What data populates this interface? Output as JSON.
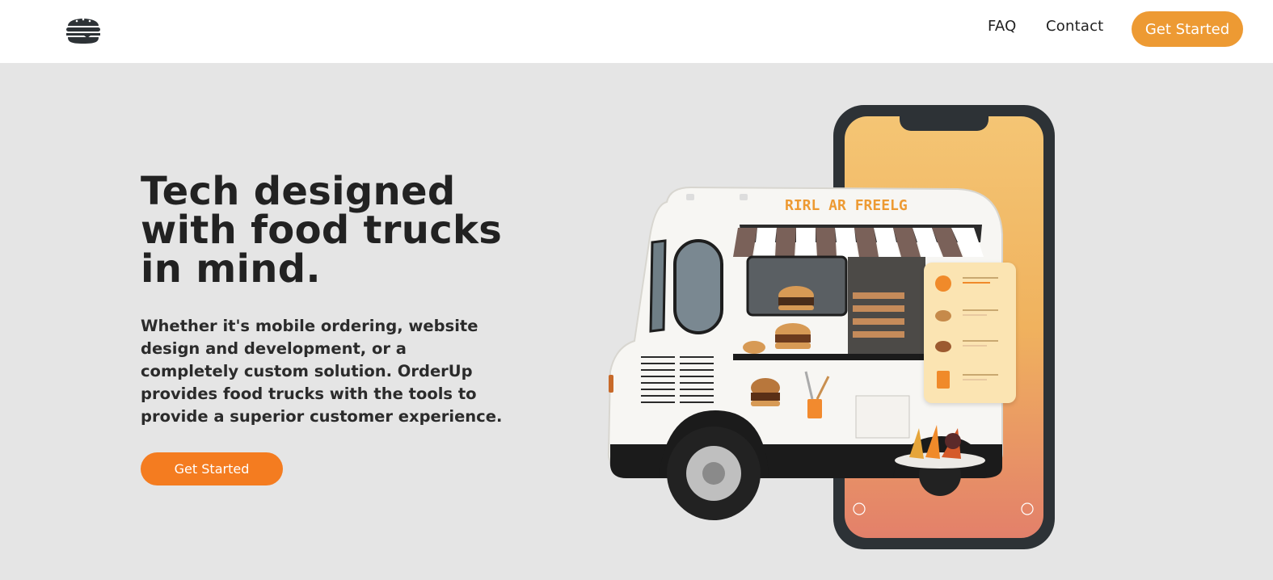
{
  "nav": {
    "links": [
      "FAQ",
      "Contact"
    ],
    "cta_label": "Get Started"
  },
  "hero": {
    "headline_lines": [
      "Tech designed",
      "with food trucks",
      "in mind."
    ],
    "subtext": "Whether it's mobile ordering, website design and development, or a completely custom solution. OrderUp provides food trucks with the tools to provide a superior customer experience.",
    "cta_label": "Get Started"
  },
  "illustration": {
    "truck_sign": "RIRL AR FREELG"
  },
  "colors": {
    "nav_cta": "#ed9a33",
    "hero_cta": "#f47c20",
    "hero_bg": "#e5e5e5",
    "phone_gradient_top": "#f4c574",
    "phone_gradient_bottom": "#e3806a"
  },
  "icons": {
    "logo": "burger-icon"
  }
}
